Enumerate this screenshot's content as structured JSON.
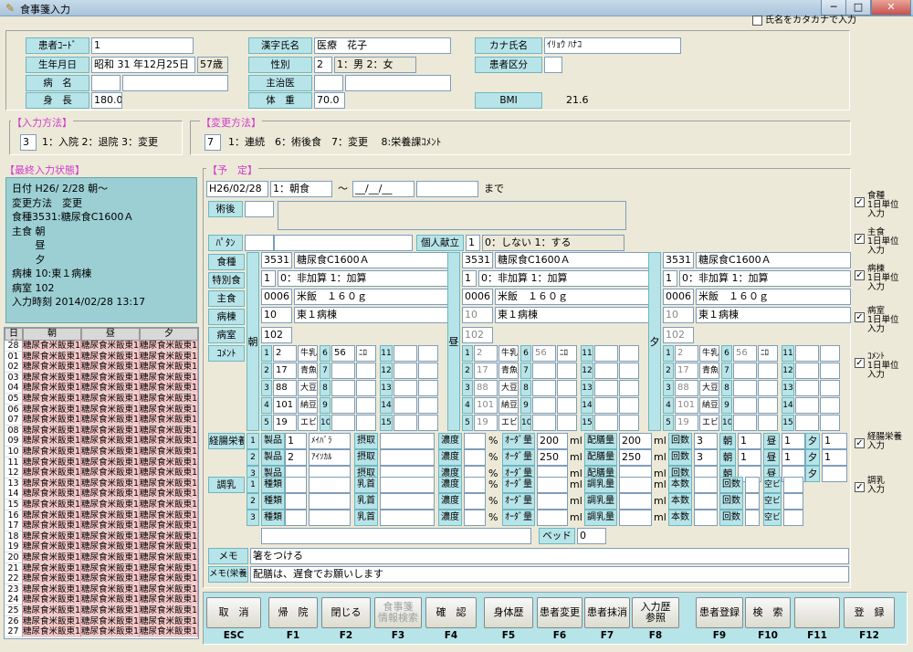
{
  "window": {
    "title": "食事箋入力",
    "min": "─",
    "max": "□",
    "close": "✕"
  },
  "kana_check": "氏名をカタカナで入力",
  "patient": {
    "id_label": "患者ｺｰﾄﾞ",
    "id": "1",
    "name_label": "漢字氏名",
    "name": "医療　花子",
    "kana_label": "カナ氏名",
    "kana": "ｲﾘｮｳ ﾊﾅｺ",
    "birth_label": "生年月日",
    "birth": "昭和 31 年12月25日",
    "age": "57歳",
    "sex_label": "性別",
    "sex_code": "2",
    "sex_opts": "1：男 2：女",
    "kubun_label": "患者区分",
    "byomei_label": "病　名",
    "doctor_label": "主治医",
    "height_label": "身　長",
    "height": "180.0",
    "weight_label": "体　重",
    "weight": "70.0",
    "bmi_label": "BMI",
    "bmi": "21.6"
  },
  "input_method": {
    "title": "【入力方法】",
    "value": "3",
    "opts": "1：入院 2：退院 3：変更"
  },
  "change_method": {
    "title": "【変更方法】",
    "value": "7",
    "opts": "1：連続　6：術後食　7：変更　 8:栄養課ｺﾒﾝﾄ"
  },
  "last": {
    "title": "【最終入力状態】",
    "lines": [
      "日付 H26/ 2/28 朝～",
      "変更方法　変更",
      "",
      "食種3531:糖尿食C1600Ａ",
      "主食 朝",
      "　　 昼",
      "　　 夕",
      "病棟 10:東１病棟",
      "病室 102",
      "入力時刻 2014/02/28 13:17"
    ]
  },
  "grid": {
    "headers": [
      "日付",
      "朝",
      "昼",
      "夕"
    ],
    "days": [
      "28",
      "01",
      "02",
      "03",
      "04",
      "05",
      "06",
      "07",
      "08",
      "09",
      "10",
      "11",
      "12",
      "13",
      "14",
      "15",
      "16",
      "17",
      "18",
      "19",
      "20",
      "21",
      "22",
      "23",
      "24",
      "25",
      "26",
      "27"
    ],
    "cell": "糖尿食米飯東1"
  },
  "yotei": {
    "title": "【予　定】",
    "date": "H26/02/28",
    "meal": "1：朝食",
    "tilde": "～",
    "date2": "__/__/__",
    "made": "まで",
    "jutsugo": "術後",
    "pattern": "ﾊﾟﾀﾝ",
    "kojin": "個人献立",
    "kojin_val": "1",
    "kojin_opts": "0：しない 1：する"
  },
  "rowlabels": {
    "shoku": "食種",
    "tokubetsu": "特別食",
    "shushoku": "主食",
    "byoto": "病棟",
    "byoshitsu": "病室",
    "comment": "ｺﾒﾝﾄ"
  },
  "cols": [
    {
      "v": "朝",
      "shoku_code": "3531",
      "shoku": "糖尿食C1600Ａ",
      "toku_code": "1",
      "toku": "0：非加算 1：加算",
      "shu_code": "0006",
      "shu": "米飯　１６０ｇ",
      "byo_code": "10",
      "byo": "東１病棟",
      "room": "102"
    },
    {
      "v": "昼",
      "shoku_code": "3531",
      "shoku": "糖尿食C1600Ａ",
      "toku_code": "1",
      "toku": "0：非加算 1：加算",
      "shu_code": "0006",
      "shu": "米飯　１６０ｇ",
      "byo_code": "10",
      "byo": "東１病棟",
      "room": "102"
    },
    {
      "v": "夕",
      "shoku_code": "3531",
      "shoku": "糖尿食C1600Ａ",
      "toku_code": "1",
      "toku": "0：非加算 1：加算",
      "shu_code": "0006",
      "shu": "米飯　１６０ｇ",
      "byo_code": "10",
      "byo": "東１病棟",
      "room": "102"
    }
  ],
  "comments": [
    {
      "n": "1",
      "code": "2",
      "txt": "牛乳ﾌﾟ"
    },
    {
      "n": "2",
      "code": "17",
      "txt": "青魚ﾀﾞ"
    },
    {
      "n": "3",
      "code": "88",
      "txt": "大豆ﾌﾟ"
    },
    {
      "n": "4",
      "code": "101",
      "txt": "納豆ﾀﾞ"
    },
    {
      "n": "5",
      "code": "19",
      "txt": "エビｲ"
    }
  ],
  "comments2": [
    {
      "n": "6",
      "code": "56",
      "txt": "ﾆﾛ"
    },
    {
      "n": "7"
    },
    {
      "n": "8"
    },
    {
      "n": "9"
    },
    {
      "n": "10"
    }
  ],
  "comments3": [
    "11",
    "12",
    "13",
    "14",
    "15"
  ],
  "keicho": {
    "label": "経腸栄養",
    "rows": [
      {
        "n": "1",
        "lb": "製品",
        "code": "1",
        "name": "ﾒｲﾊﾞﾗ",
        "noudo": "濃度",
        "ordq": "ｵｰﾀﾞ量",
        "ordv": "200",
        "haiq": "配膳量",
        "haiv": "200",
        "kai": "回数",
        "kaiv": "3",
        "asa": "朝",
        "asav": "1",
        "hiru": "昼",
        "hiruv": "1",
        "yu": "夕",
        "yuv": "1"
      },
      {
        "n": "2",
        "lb": "製品",
        "code": "2",
        "name": "ｱｲｿｶﾙ",
        "noudo": "濃度",
        "ordq": "ｵｰﾀﾞ量",
        "ordv": "250",
        "haiq": "配膳量",
        "haiv": "250",
        "kai": "回数",
        "kaiv": "3",
        "asa": "朝",
        "asav": "1",
        "hiru": "昼",
        "hiruv": "1",
        "yu": "夕",
        "yuv": "1"
      },
      {
        "n": "3",
        "lb": "製品",
        "code": "",
        "name": "",
        "noudo": "濃度",
        "ordq": "ｵｰﾀﾞ量",
        "ordv": "",
        "haiq": "配膳量",
        "haiv": "",
        "kai": "回数",
        "kaiv": "",
        "asa": "朝",
        "asav": "",
        "hiru": "昼",
        "hiruv": "",
        "yu": "夕",
        "yuv": ""
      }
    ],
    "sesshu": "摂取",
    "pct": "%",
    "ml": "ml"
  },
  "chonyu": {
    "label": "調乳",
    "rows": [
      {
        "n": "1"
      },
      {
        "n": "2"
      },
      {
        "n": "3"
      }
    ],
    "shurui": "種類",
    "nyukubi": "乳首",
    "noudo": "濃度",
    "ordq": "ｵｰﾀﾞ量",
    "chonyuq": "調乳量",
    "hon": "本数",
    "kai": "回数",
    "akibin": "空ビン"
  },
  "bed": {
    "label": "ベッド",
    "value": "0"
  },
  "memo": {
    "label": "メモ",
    "value": "箸をつける",
    "label2": "メモ(栄養)",
    "value2": "配膳は、遅食でお願いします"
  },
  "side": [
    {
      "lbl": "食種\n1日単位\n入力"
    },
    {
      "lbl": "主食\n1日単位\n入力"
    },
    {
      "lbl": "病棟\n1日単位\n入力"
    },
    {
      "lbl": "病室\n1日単位\n入力"
    },
    {
      "lbl": "ｺﾒﾝﾄ\n1日単位\n入力"
    },
    {
      "lbl": "経腸栄養\n入力"
    },
    {
      "lbl": "調乳\n入力"
    }
  ],
  "check": "✓",
  "buttons": [
    {
      "lbl": "取　消",
      "key": "ESC"
    },
    {
      "lbl": "帰　院",
      "key": "F1"
    },
    {
      "lbl": "閉じる",
      "key": "F2"
    },
    {
      "lbl": "食事箋\n情報検索",
      "key": "F3"
    },
    {
      "lbl": "確　認",
      "key": "F4"
    },
    {
      "lbl": "身体歴",
      "key": "F5"
    },
    {
      "lbl": "患者変更",
      "key": "F6"
    },
    {
      "lbl": "患者抹消",
      "key": "F7"
    },
    {
      "lbl": "入力歴\n参照",
      "key": "F8"
    },
    {
      "lbl": "患者登録",
      "key": "F9"
    },
    {
      "lbl": "検　索",
      "key": "F10"
    },
    {
      "lbl": "",
      "key": "F11"
    },
    {
      "lbl": "登　録",
      "key": "F12"
    }
  ]
}
